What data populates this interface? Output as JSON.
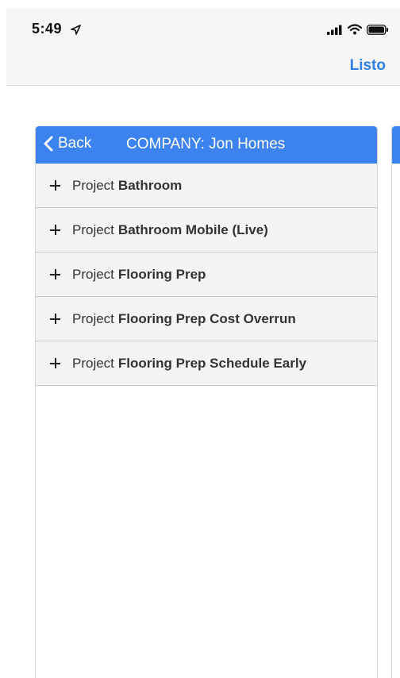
{
  "status_bar": {
    "time": "5:49",
    "icons": [
      "location-arrow-icon",
      "signal-icon",
      "wifi-icon",
      "battery-icon"
    ]
  },
  "nav": {
    "done_label": "Listo"
  },
  "panel": {
    "back_label": "Back",
    "title": "COMPANY: Jon Homes",
    "header_color": "#3d83ef",
    "items": [
      {
        "prefix": "Project",
        "name": "Bathroom"
      },
      {
        "prefix": "Project",
        "name": "Bathroom Mobile (Live)"
      },
      {
        "prefix": "Project",
        "name": "Flooring Prep"
      },
      {
        "prefix": "Project",
        "name": "Flooring Prep Cost Overrun"
      },
      {
        "prefix": "Project",
        "name": "Flooring Prep Schedule Early"
      }
    ]
  },
  "colors": {
    "accent": "#2f80e8",
    "header": "#3d83ef",
    "row_bg": "#f5f4f4"
  }
}
